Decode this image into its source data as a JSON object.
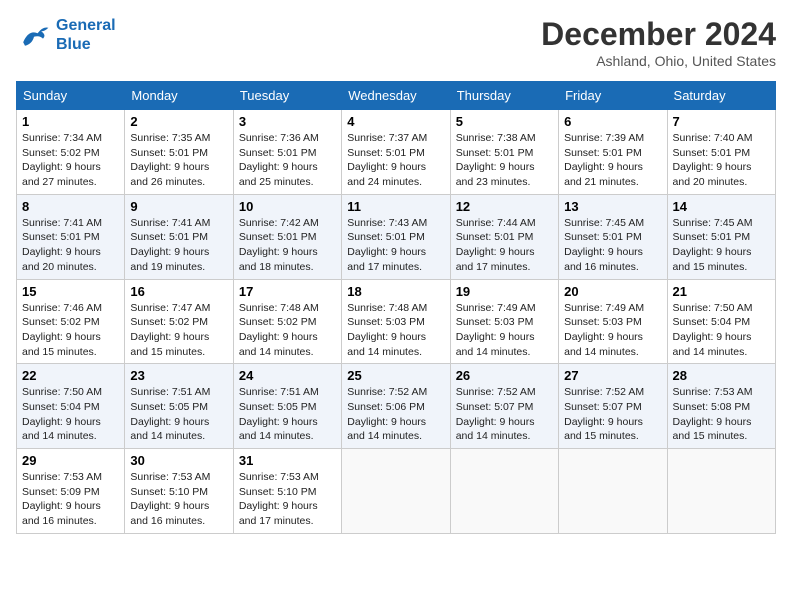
{
  "logo": {
    "line1": "General",
    "line2": "Blue"
  },
  "title": "December 2024",
  "location": "Ashland, Ohio, United States",
  "days_of_week": [
    "Sunday",
    "Monday",
    "Tuesday",
    "Wednesday",
    "Thursday",
    "Friday",
    "Saturday"
  ],
  "weeks": [
    [
      {
        "day": 1,
        "sunrise": "7:34 AM",
        "sunset": "5:02 PM",
        "daylight": "9 hours and 27 minutes."
      },
      {
        "day": 2,
        "sunrise": "7:35 AM",
        "sunset": "5:01 PM",
        "daylight": "9 hours and 26 minutes."
      },
      {
        "day": 3,
        "sunrise": "7:36 AM",
        "sunset": "5:01 PM",
        "daylight": "9 hours and 25 minutes."
      },
      {
        "day": 4,
        "sunrise": "7:37 AM",
        "sunset": "5:01 PM",
        "daylight": "9 hours and 24 minutes."
      },
      {
        "day": 5,
        "sunrise": "7:38 AM",
        "sunset": "5:01 PM",
        "daylight": "9 hours and 23 minutes."
      },
      {
        "day": 6,
        "sunrise": "7:39 AM",
        "sunset": "5:01 PM",
        "daylight": "9 hours and 21 minutes."
      },
      {
        "day": 7,
        "sunrise": "7:40 AM",
        "sunset": "5:01 PM",
        "daylight": "9 hours and 20 minutes."
      }
    ],
    [
      {
        "day": 8,
        "sunrise": "7:41 AM",
        "sunset": "5:01 PM",
        "daylight": "9 hours and 20 minutes."
      },
      {
        "day": 9,
        "sunrise": "7:41 AM",
        "sunset": "5:01 PM",
        "daylight": "9 hours and 19 minutes."
      },
      {
        "day": 10,
        "sunrise": "7:42 AM",
        "sunset": "5:01 PM",
        "daylight": "9 hours and 18 minutes."
      },
      {
        "day": 11,
        "sunrise": "7:43 AM",
        "sunset": "5:01 PM",
        "daylight": "9 hours and 17 minutes."
      },
      {
        "day": 12,
        "sunrise": "7:44 AM",
        "sunset": "5:01 PM",
        "daylight": "9 hours and 17 minutes."
      },
      {
        "day": 13,
        "sunrise": "7:45 AM",
        "sunset": "5:01 PM",
        "daylight": "9 hours and 16 minutes."
      },
      {
        "day": 14,
        "sunrise": "7:45 AM",
        "sunset": "5:01 PM",
        "daylight": "9 hours and 15 minutes."
      }
    ],
    [
      {
        "day": 15,
        "sunrise": "7:46 AM",
        "sunset": "5:02 PM",
        "daylight": "9 hours and 15 minutes."
      },
      {
        "day": 16,
        "sunrise": "7:47 AM",
        "sunset": "5:02 PM",
        "daylight": "9 hours and 15 minutes."
      },
      {
        "day": 17,
        "sunrise": "7:48 AM",
        "sunset": "5:02 PM",
        "daylight": "9 hours and 14 minutes."
      },
      {
        "day": 18,
        "sunrise": "7:48 AM",
        "sunset": "5:03 PM",
        "daylight": "9 hours and 14 minutes."
      },
      {
        "day": 19,
        "sunrise": "7:49 AM",
        "sunset": "5:03 PM",
        "daylight": "9 hours and 14 minutes."
      },
      {
        "day": 20,
        "sunrise": "7:49 AM",
        "sunset": "5:03 PM",
        "daylight": "9 hours and 14 minutes."
      },
      {
        "day": 21,
        "sunrise": "7:50 AM",
        "sunset": "5:04 PM",
        "daylight": "9 hours and 14 minutes."
      }
    ],
    [
      {
        "day": 22,
        "sunrise": "7:50 AM",
        "sunset": "5:04 PM",
        "daylight": "9 hours and 14 minutes."
      },
      {
        "day": 23,
        "sunrise": "7:51 AM",
        "sunset": "5:05 PM",
        "daylight": "9 hours and 14 minutes."
      },
      {
        "day": 24,
        "sunrise": "7:51 AM",
        "sunset": "5:05 PM",
        "daylight": "9 hours and 14 minutes."
      },
      {
        "day": 25,
        "sunrise": "7:52 AM",
        "sunset": "5:06 PM",
        "daylight": "9 hours and 14 minutes."
      },
      {
        "day": 26,
        "sunrise": "7:52 AM",
        "sunset": "5:07 PM",
        "daylight": "9 hours and 14 minutes."
      },
      {
        "day": 27,
        "sunrise": "7:52 AM",
        "sunset": "5:07 PM",
        "daylight": "9 hours and 15 minutes."
      },
      {
        "day": 28,
        "sunrise": "7:53 AM",
        "sunset": "5:08 PM",
        "daylight": "9 hours and 15 minutes."
      }
    ],
    [
      {
        "day": 29,
        "sunrise": "7:53 AM",
        "sunset": "5:09 PM",
        "daylight": "9 hours and 16 minutes."
      },
      {
        "day": 30,
        "sunrise": "7:53 AM",
        "sunset": "5:10 PM",
        "daylight": "9 hours and 16 minutes."
      },
      {
        "day": 31,
        "sunrise": "7:53 AM",
        "sunset": "5:10 PM",
        "daylight": "9 hours and 17 minutes."
      },
      null,
      null,
      null,
      null
    ]
  ]
}
